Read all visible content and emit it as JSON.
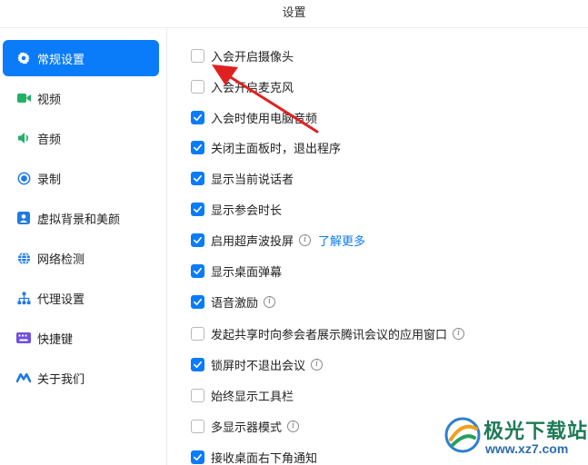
{
  "window": {
    "title": "设置"
  },
  "sidebar": {
    "items": [
      {
        "label": "常规设置",
        "icon": "gear-icon",
        "active": true
      },
      {
        "label": "视频",
        "icon": "video-camera-icon",
        "active": false
      },
      {
        "label": "音频",
        "icon": "speaker-icon",
        "active": false
      },
      {
        "label": "录制",
        "icon": "record-icon",
        "active": false
      },
      {
        "label": "虚拟背景和美颜",
        "icon": "portrait-icon",
        "active": false
      },
      {
        "label": "网络检测",
        "icon": "globe-icon",
        "active": false
      },
      {
        "label": "代理设置",
        "icon": "network-tree-icon",
        "active": false
      },
      {
        "label": "快捷键",
        "icon": "keyboard-icon",
        "active": false
      },
      {
        "label": "关于我们",
        "icon": "brand-logo-icon",
        "active": false
      }
    ]
  },
  "options": [
    {
      "label": "入会开启摄像头",
      "checked": false
    },
    {
      "label": "入会开启麦克风",
      "checked": false
    },
    {
      "label": "入会时使用电脑音频",
      "checked": true
    },
    {
      "label": "关闭主面板时，退出程序",
      "checked": true
    },
    {
      "label": "显示当前说话者",
      "checked": true
    },
    {
      "label": "显示参会时长",
      "checked": true
    },
    {
      "label": "启用超声波投屏",
      "checked": true,
      "info": true,
      "link": "了解更多"
    },
    {
      "label": "显示桌面弹幕",
      "checked": true
    },
    {
      "label": "语音激励",
      "checked": true,
      "info": true
    },
    {
      "label": "发起共享时向参会者展示腾讯会议的应用窗口",
      "checked": false,
      "info": true
    },
    {
      "label": "锁屏时不退出会议",
      "checked": true,
      "info": true
    },
    {
      "label": "始终显示工具栏",
      "checked": false
    },
    {
      "label": "多显示器模式",
      "checked": false,
      "info": true
    },
    {
      "label": "接收桌面右下角通知",
      "checked": true
    }
  ],
  "watermark": {
    "name": "极光下载站",
    "url": "www.xz7.com"
  },
  "colors": {
    "accent": "#0b7cf9",
    "annotation_arrow": "#e02020"
  }
}
